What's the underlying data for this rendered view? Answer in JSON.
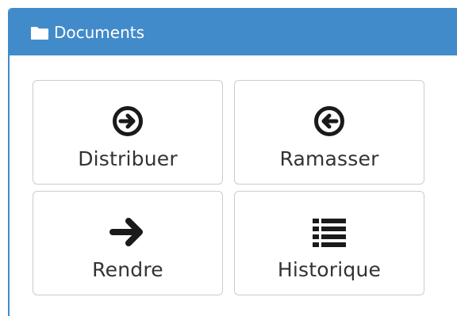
{
  "panel": {
    "title": "Documents",
    "icon": "folder-icon"
  },
  "actions": [
    {
      "label": "Distribuer",
      "icon": "circle-arrow-right-icon"
    },
    {
      "label": "Ramasser",
      "icon": "circle-arrow-left-icon"
    },
    {
      "label": "Rendre",
      "icon": "arrow-right-icon"
    },
    {
      "label": "Historique",
      "icon": "list-icon"
    }
  ],
  "colors": {
    "header_bg": "#428bca",
    "header_text": "#ffffff",
    "button_border": "#cccccc",
    "text": "#333333",
    "icon": "#1a1a1a"
  }
}
